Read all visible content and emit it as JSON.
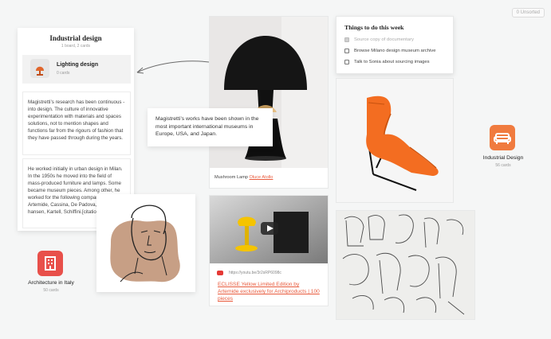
{
  "board": {
    "unsorted_label": "0 Unsorted"
  },
  "column": {
    "title": "Industrial design",
    "subtitle": "1 board, 2 cards",
    "board_item": {
      "title": "Lighting design",
      "subtitle": "0 cards"
    },
    "note1": "Magistretti’s research has been continuous - into design. The culture of innovative experimentation with materials and spaces solutions, not to mention shapes and functions far from the rigours of fashion that they have passed through during the years.",
    "note2": "He worked initially in urban design in Milan. In the 1950s he moved into the field of mass-produced furniture and lamps. Some became museum pieces. Among other, he worked for the following companies: Artemide, Cassina, De Padova, Flou, Fritz hansen, Kartell, Schiffini.[citation needed]"
  },
  "quote": {
    "text": "Magistretti’s works have been shown in the most important international museums in Europe, USA, and Japan."
  },
  "lamp_card": {
    "caption_prefix": "Mushroom Lamp",
    "caption_link": "Oluce Atollo"
  },
  "todo": {
    "title": "Things to do this week",
    "items": [
      {
        "label": "Source copy of documentary",
        "checked": true
      },
      {
        "label": "Browse Milano design museum archive",
        "checked": false
      },
      {
        "label": "Talk to Sonia about sourcing images",
        "checked": false
      }
    ]
  },
  "boards": {
    "industrial": {
      "title": "Industrial Design",
      "subtitle": "56 cards",
      "color": "#f07b3f",
      "icon": "sofa-icon"
    },
    "architecture": {
      "title": "Architecture in Italy",
      "subtitle": "50 cards",
      "color": "#e8504a",
      "icon": "building-icon"
    }
  },
  "video_card": {
    "url": "https://youtu.be/3r2sRP6098c",
    "title": "ECLISSE Yellow Limited Edition by Artemide exclusively for Archiproducts | 100 pieces"
  },
  "colors": {
    "accent": "#e85a3c",
    "background": "#f5f6f6"
  }
}
